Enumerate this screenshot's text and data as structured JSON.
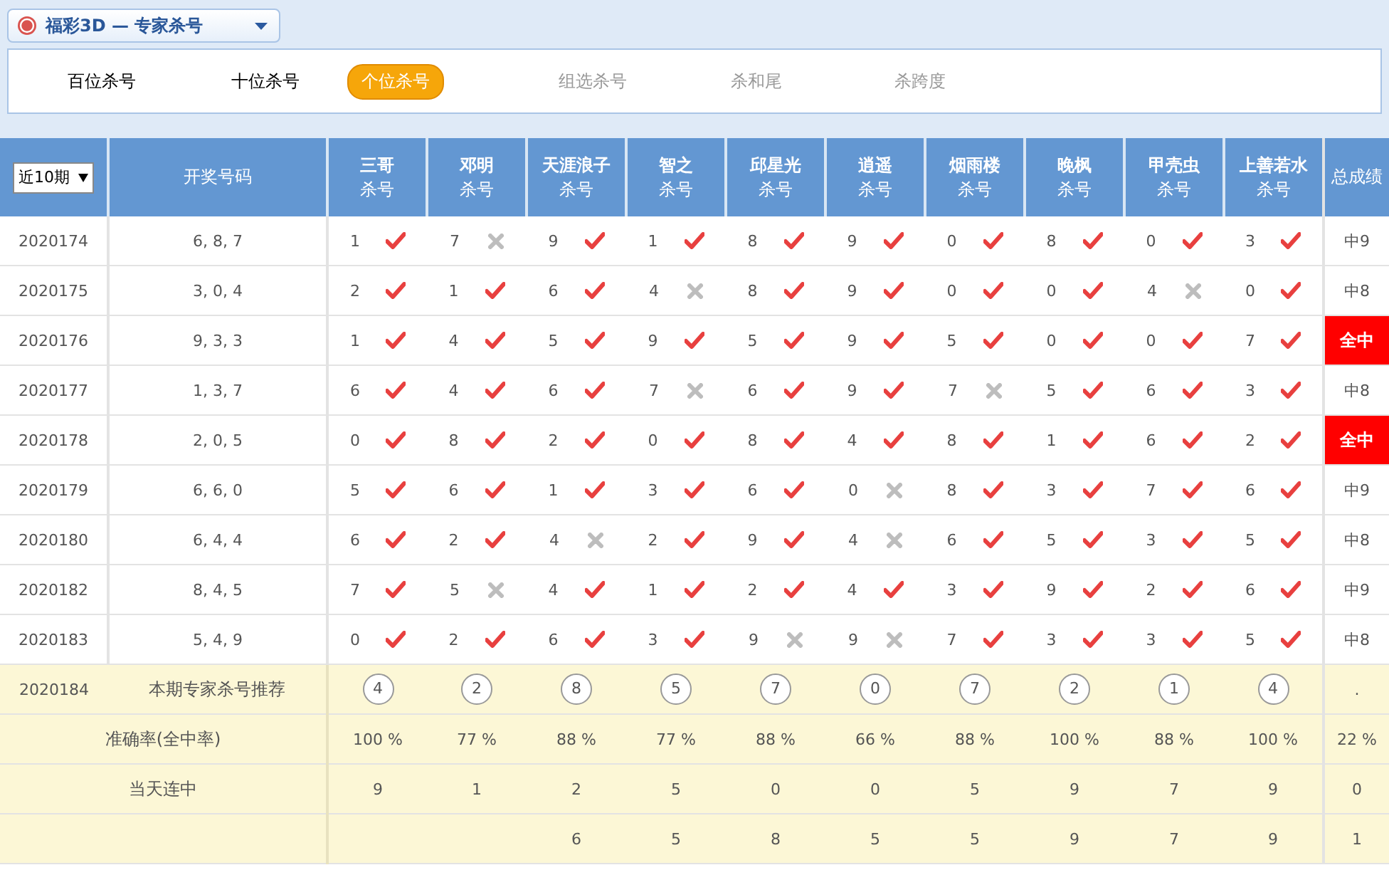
{
  "header": {
    "selector": "福彩3D — 专家杀号"
  },
  "tabs": [
    {
      "label": "百位杀号",
      "selected": false,
      "disabled": false
    },
    {
      "label": "十位杀号",
      "selected": false,
      "disabled": false
    },
    {
      "label": "个位杀号",
      "selected": true,
      "disabled": false
    },
    {
      "label": "组选杀号",
      "selected": false,
      "disabled": true
    },
    {
      "label": "杀和尾",
      "selected": false,
      "disabled": true
    },
    {
      "label": "杀跨度",
      "selected": false,
      "disabled": true
    }
  ],
  "table": {
    "period_select": "近10期",
    "draw_heading": "开奖号码",
    "total_heading": "总成绩",
    "experts": [
      {
        "name": "三哥",
        "sub": "杀号"
      },
      {
        "name": "邓明",
        "sub": "杀号"
      },
      {
        "name": "天涯浪子",
        "sub": "杀号"
      },
      {
        "name": "智之",
        "sub": "杀号"
      },
      {
        "name": "邱星光",
        "sub": "杀号"
      },
      {
        "name": "逍遥",
        "sub": "杀号"
      },
      {
        "name": "烟雨楼",
        "sub": "杀号"
      },
      {
        "name": "晚枫",
        "sub": "杀号"
      },
      {
        "name": "甲壳虫",
        "sub": "杀号"
      },
      {
        "name": "上善若水",
        "sub": "杀号"
      }
    ],
    "rows": [
      {
        "issue": "2020174",
        "numbers": "6, 8, 7",
        "kills": [
          {
            "n": "1",
            "hit": true
          },
          {
            "n": "7",
            "hit": false
          },
          {
            "n": "9",
            "hit": true
          },
          {
            "n": "1",
            "hit": true
          },
          {
            "n": "8",
            "hit": true
          },
          {
            "n": "9",
            "hit": true
          },
          {
            "n": "0",
            "hit": true
          },
          {
            "n": "8",
            "hit": true
          },
          {
            "n": "0",
            "hit": true
          },
          {
            "n": "3",
            "hit": true
          }
        ],
        "total": "中9",
        "full": false
      },
      {
        "issue": "2020175",
        "numbers": "3, 0, 4",
        "kills": [
          {
            "n": "2",
            "hit": true
          },
          {
            "n": "1",
            "hit": true
          },
          {
            "n": "6",
            "hit": true
          },
          {
            "n": "4",
            "hit": false
          },
          {
            "n": "8",
            "hit": true
          },
          {
            "n": "9",
            "hit": true
          },
          {
            "n": "0",
            "hit": true
          },
          {
            "n": "0",
            "hit": true
          },
          {
            "n": "4",
            "hit": false
          },
          {
            "n": "0",
            "hit": true
          }
        ],
        "total": "中8",
        "full": false
      },
      {
        "issue": "2020176",
        "numbers": "9, 3, 3",
        "kills": [
          {
            "n": "1",
            "hit": true
          },
          {
            "n": "4",
            "hit": true
          },
          {
            "n": "5",
            "hit": true
          },
          {
            "n": "9",
            "hit": true
          },
          {
            "n": "5",
            "hit": true
          },
          {
            "n": "9",
            "hit": true
          },
          {
            "n": "5",
            "hit": true
          },
          {
            "n": "0",
            "hit": true
          },
          {
            "n": "0",
            "hit": true
          },
          {
            "n": "7",
            "hit": true
          }
        ],
        "total": "全中",
        "full": true
      },
      {
        "issue": "2020177",
        "numbers": "1, 3, 7",
        "kills": [
          {
            "n": "6",
            "hit": true
          },
          {
            "n": "4",
            "hit": true
          },
          {
            "n": "6",
            "hit": true
          },
          {
            "n": "7",
            "hit": false
          },
          {
            "n": "6",
            "hit": true
          },
          {
            "n": "9",
            "hit": true
          },
          {
            "n": "7",
            "hit": false
          },
          {
            "n": "5",
            "hit": true
          },
          {
            "n": "6",
            "hit": true
          },
          {
            "n": "3",
            "hit": true
          }
        ],
        "total": "中8",
        "full": false
      },
      {
        "issue": "2020178",
        "numbers": "2, 0, 5",
        "kills": [
          {
            "n": "0",
            "hit": true
          },
          {
            "n": "8",
            "hit": true
          },
          {
            "n": "2",
            "hit": true
          },
          {
            "n": "0",
            "hit": true
          },
          {
            "n": "8",
            "hit": true
          },
          {
            "n": "4",
            "hit": true
          },
          {
            "n": "8",
            "hit": true
          },
          {
            "n": "1",
            "hit": true
          },
          {
            "n": "6",
            "hit": true
          },
          {
            "n": "2",
            "hit": true
          }
        ],
        "total": "全中",
        "full": true
      },
      {
        "issue": "2020179",
        "numbers": "6, 6, 0",
        "kills": [
          {
            "n": "5",
            "hit": true
          },
          {
            "n": "6",
            "hit": true
          },
          {
            "n": "1",
            "hit": true
          },
          {
            "n": "3",
            "hit": true
          },
          {
            "n": "6",
            "hit": true
          },
          {
            "n": "0",
            "hit": false
          },
          {
            "n": "8",
            "hit": true
          },
          {
            "n": "3",
            "hit": true
          },
          {
            "n": "7",
            "hit": true
          },
          {
            "n": "6",
            "hit": true
          }
        ],
        "total": "中9",
        "full": false
      },
      {
        "issue": "2020180",
        "numbers": "6, 4, 4",
        "kills": [
          {
            "n": "6",
            "hit": true
          },
          {
            "n": "2",
            "hit": true
          },
          {
            "n": "4",
            "hit": false
          },
          {
            "n": "2",
            "hit": true
          },
          {
            "n": "9",
            "hit": true
          },
          {
            "n": "4",
            "hit": false
          },
          {
            "n": "6",
            "hit": true
          },
          {
            "n": "5",
            "hit": true
          },
          {
            "n": "3",
            "hit": true
          },
          {
            "n": "5",
            "hit": true
          }
        ],
        "total": "中8",
        "full": false
      },
      {
        "issue": "2020182",
        "numbers": "8, 4, 5",
        "kills": [
          {
            "n": "7",
            "hit": true
          },
          {
            "n": "5",
            "hit": false
          },
          {
            "n": "4",
            "hit": true
          },
          {
            "n": "1",
            "hit": true
          },
          {
            "n": "2",
            "hit": true
          },
          {
            "n": "4",
            "hit": true
          },
          {
            "n": "3",
            "hit": true
          },
          {
            "n": "9",
            "hit": true
          },
          {
            "n": "2",
            "hit": true
          },
          {
            "n": "6",
            "hit": true
          }
        ],
        "total": "中9",
        "full": false
      },
      {
        "issue": "2020183",
        "numbers": "5, 4, 9",
        "kills": [
          {
            "n": "0",
            "hit": true
          },
          {
            "n": "2",
            "hit": true
          },
          {
            "n": "6",
            "hit": true
          },
          {
            "n": "3",
            "hit": true
          },
          {
            "n": "9",
            "hit": false
          },
          {
            "n": "9",
            "hit": false
          },
          {
            "n": "7",
            "hit": true
          },
          {
            "n": "3",
            "hit": true
          },
          {
            "n": "3",
            "hit": true
          },
          {
            "n": "5",
            "hit": true
          }
        ],
        "total": "中8",
        "full": false
      }
    ],
    "recommendation": {
      "issue": "2020184",
      "label": "本期专家杀号推荐",
      "numbers": [
        "4",
        "2",
        "8",
        "5",
        "7",
        "0",
        "7",
        "2",
        "1",
        "4"
      ],
      "total": "."
    },
    "summary": [
      {
        "label": "准确率(全中率)",
        "values": [
          "100 %",
          "77 %",
          "88 %",
          "77 %",
          "88 %",
          "66 %",
          "88 %",
          "100 %",
          "88 %",
          "100 %",
          "22 %"
        ]
      },
      {
        "label": "当天连中",
        "values": [
          "9",
          "1",
          "2",
          "5",
          "0",
          "0",
          "5",
          "9",
          "7",
          "9",
          "0"
        ]
      },
      {
        "values": [
          "6",
          "5",
          "8",
          "5",
          "5",
          "9",
          "7",
          "9",
          "1"
        ]
      }
    ]
  }
}
